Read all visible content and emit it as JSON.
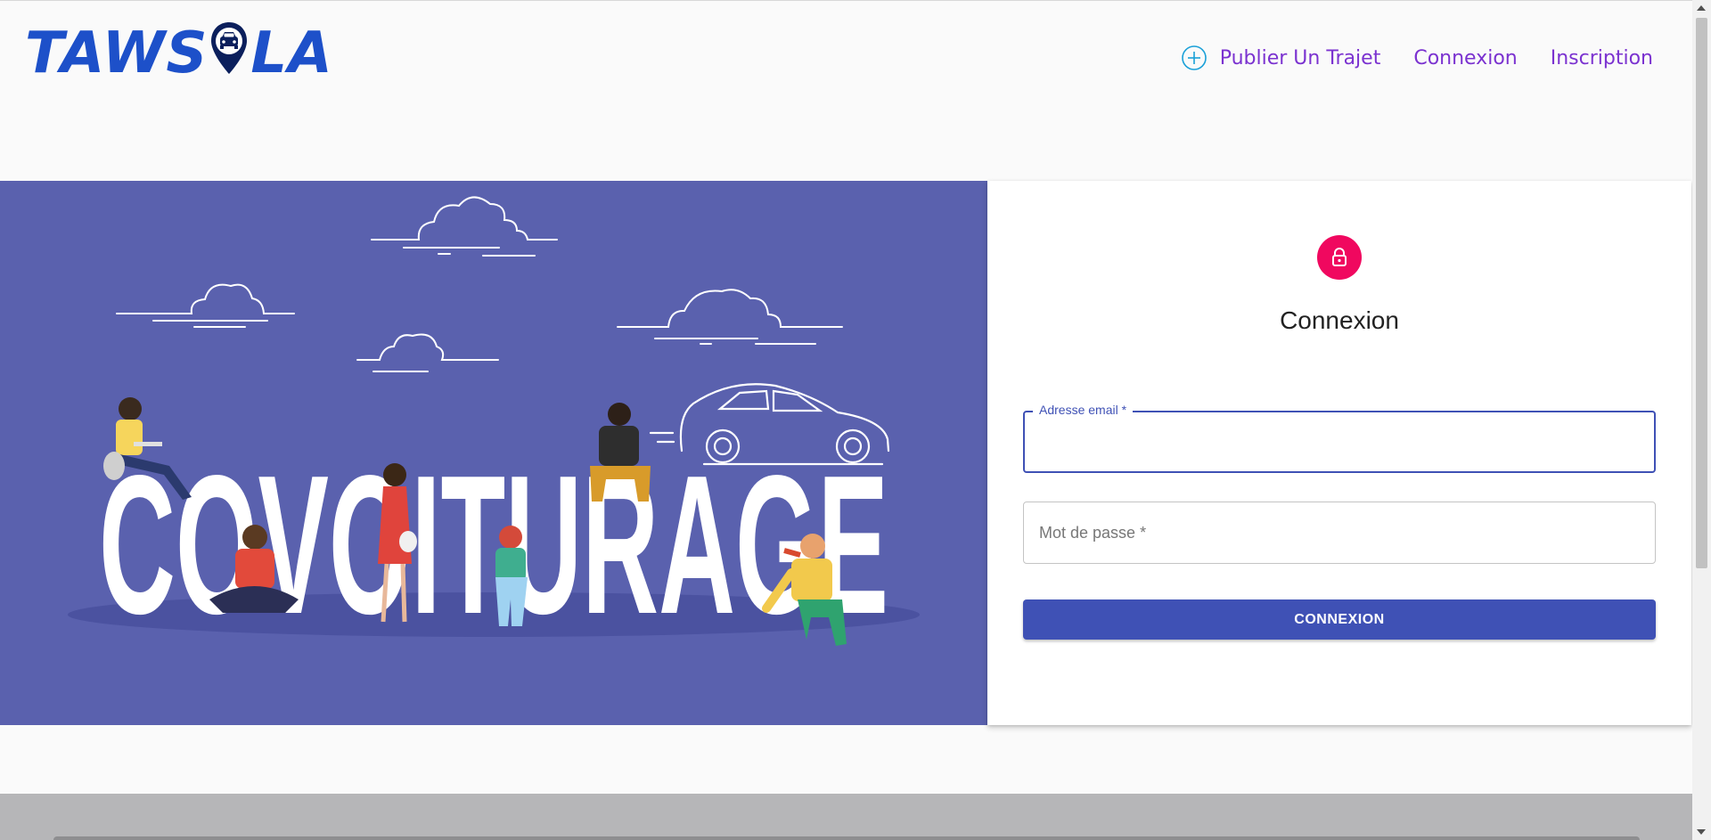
{
  "brand": {
    "logo_left": "TAWS",
    "logo_right": "LA"
  },
  "nav": {
    "publish_label": "Publier Un Trajet",
    "login_label": "Connexion",
    "signup_label": "Inscription",
    "publish_icon": "plus-circle-icon"
  },
  "hero": {
    "word": "COVOITURAGE"
  },
  "login": {
    "icon": "lock-icon",
    "title": "Connexion",
    "email_label": "Adresse email *",
    "email_value": "",
    "password_placeholder": "Mot de passe *",
    "password_value": "",
    "submit_label": "CONNEXION"
  },
  "colors": {
    "brand": "#1d50c9",
    "nav_link": "#7b32d0",
    "accent": "#3f51b5",
    "lock_bg": "#f0085f",
    "hero_bg": "#5a61ae"
  }
}
